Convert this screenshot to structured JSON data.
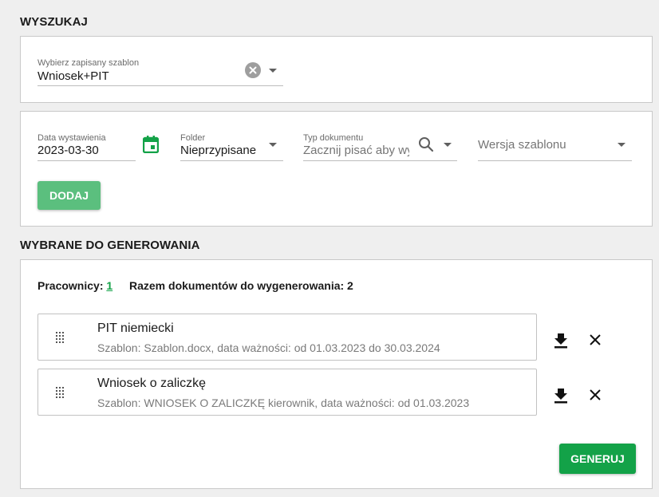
{
  "search": {
    "title": "WYSZUKAJ",
    "template_select": {
      "label": "Wybierz zapisany szablon",
      "value": "Wniosek+PIT"
    },
    "issue_date": {
      "label": "Data wystawienia",
      "value": "2023-03-30"
    },
    "folder": {
      "label": "Folder",
      "value": "Nieprzypisane"
    },
    "doc_type": {
      "label": "Typ dokumentu",
      "placeholder": "Zacznij pisać aby wy"
    },
    "template_version": {
      "placeholder": "Wersja szablonu"
    },
    "add_button": "DODAJ"
  },
  "selected": {
    "title": "WYBRANE DO GENEROWANIA",
    "employees_label": "Pracownicy:",
    "employees_count": "1",
    "total_label": "Razem dokumentów do wygenerowania: 2",
    "documents": [
      {
        "title": "PIT niemiecki",
        "subtitle": "Szablon: Szablon.docx, data ważności: od 01.03.2023 do 30.03.2024"
      },
      {
        "title": "Wniosek o zaliczkę",
        "subtitle": "Szablon: WNIOSEK O ZALICZKĘ kierownik, data ważności: od 01.03.2023"
      }
    ],
    "generate_button": "GENERUJ"
  },
  "colors": {
    "accent_green": "#13a248",
    "add_button_green": "#5bbf7e",
    "calendar_icon_green": "#13a248"
  },
  "icons": {
    "clear": "close-circle-icon",
    "dropdown": "chevron-down-icon",
    "calendar": "calendar-icon",
    "search": "search-icon",
    "drag": "drag-handle-icon",
    "download": "download-icon",
    "remove": "close-icon"
  }
}
